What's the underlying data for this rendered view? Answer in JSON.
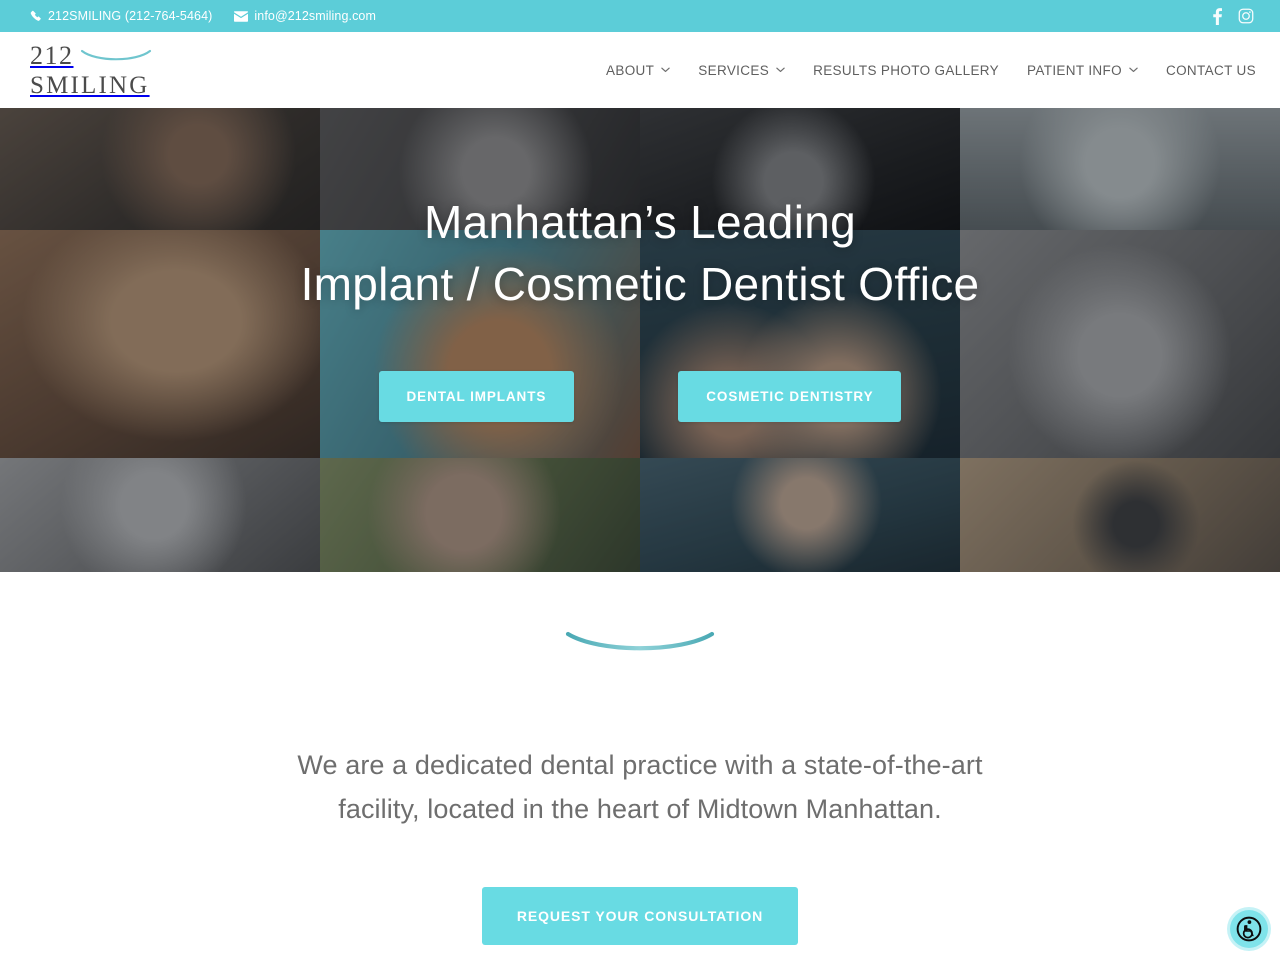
{
  "topbar": {
    "phone": "212SMILING (212-764-5464)",
    "phone_icon": "phone-icon",
    "email": "info@212smiling.com",
    "email_icon": "envelope-icon",
    "social": [
      {
        "name": "facebook-icon",
        "label": "f"
      },
      {
        "name": "instagram-icon",
        "label": ""
      }
    ],
    "bg_color": "#5ccdd8"
  },
  "logo": {
    "line1": "212",
    "line2": "SMILING",
    "curve_color": "#6fc5ce"
  },
  "nav": {
    "items": [
      {
        "label": "ABOUT",
        "has_dropdown": true
      },
      {
        "label": "SERVICES",
        "has_dropdown": true
      },
      {
        "label": "RESULTS PHOTO GALLERY",
        "has_dropdown": false
      },
      {
        "label": "PATIENT INFO",
        "has_dropdown": true
      },
      {
        "label": "CONTACT US",
        "has_dropdown": false
      }
    ]
  },
  "hero": {
    "title_line1": "Manhattan’s Leading",
    "title_line2": "Implant / Cosmetic Dentist Office",
    "buttons": [
      {
        "label": "DENTAL IMPLANTS"
      },
      {
        "label": "COSMETIC DENTISTRY"
      }
    ],
    "button_color": "#68dbe3",
    "photos": [
      {
        "alt": "woman-plaid-shirt-smiling",
        "c1": "#6b5a4a",
        "c2": "#2b2720"
      },
      {
        "alt": "woman-turtleneck-sweater",
        "c1": "#5d5a58",
        "c2": "#32302f"
      },
      {
        "alt": "man-black-and-white-smiling",
        "c1": "#4a4a4a",
        "c2": "#0b0b0b"
      },
      {
        "alt": "woman-ponytail-embroidered-top",
        "c1": "#9aa2a4",
        "c2": "#6d7577"
      },
      {
        "alt": "woman-closeup-eyes-smiling",
        "c1": "#b08a63",
        "c2": "#5a4030"
      },
      {
        "alt": "child-red-hair-laughing",
        "c1": "#5fb9c6",
        "c2": "#8a5f3f"
      },
      {
        "alt": "couple-in-car-smiling",
        "c1": "#2f4f5c",
        "c2": "#16262d"
      },
      {
        "alt": "woman-sunglasses-black-and-white",
        "c1": "#8d8d8d",
        "c2": "#4a4a4a"
      },
      {
        "alt": "boy-cap-black-and-white-laughing",
        "c1": "#9d9d9d",
        "c2": "#5a5a5a"
      },
      {
        "alt": "woman-laughing-outdoors",
        "c1": "#7e8f5e",
        "c2": "#3c4a2c"
      },
      {
        "alt": "mother-with-two-children-in-car",
        "c1": "#44616d",
        "c2": "#1d3038"
      },
      {
        "alt": "man-aviator-sunglasses",
        "c1": "#b99f7f",
        "c2": "#6a594a"
      }
    ]
  },
  "intro": {
    "divider_icon": "smile-curve-divider",
    "paragraph": "We are a dedicated dental practice with a state-of-the-art facility, located in the heart of Midtown Manhattan.",
    "cta_label": "REQUEST YOUR CONSULTATION"
  },
  "accessibility": {
    "icon": "wheelchair-accessibility-icon",
    "label": "Accessibility"
  }
}
